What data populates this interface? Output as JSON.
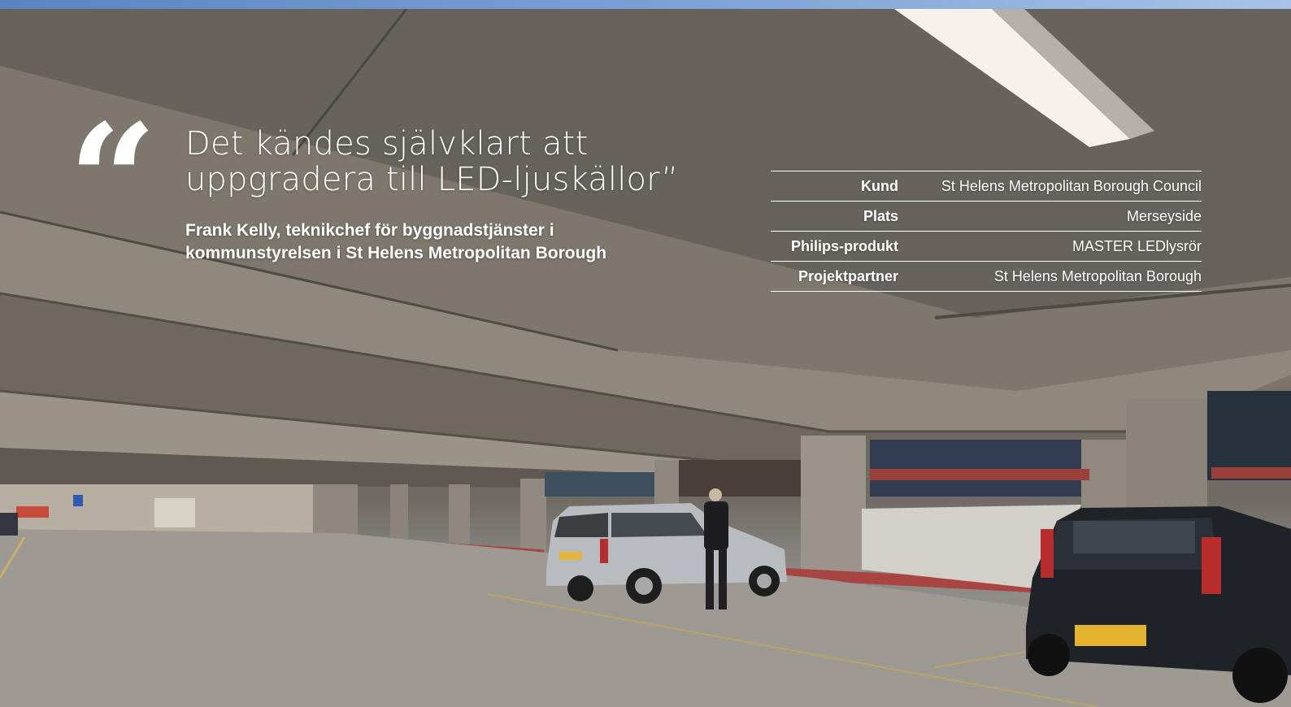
{
  "quote": {
    "mark": "“",
    "headline": "Det kändes självklart att uppgradera till LED-ljuskällor”",
    "attribution_line1": "Frank Kelly, teknikchef för byggnadstjänster i",
    "attribution_line2": "kommunstyrelsen i St Helens Metropolitan Borough"
  },
  "facts": [
    {
      "label": "Kund",
      "value": "St Helens Metropolitan Borough Council"
    },
    {
      "label": "Plats",
      "value": "Merseyside"
    },
    {
      "label": "Philips-produkt",
      "value": "MASTER LEDlysrör"
    },
    {
      "label": "Projektpartner",
      "value": "St Helens Metropolitan Borough"
    }
  ],
  "colors": {
    "top_bar": "#82a6d8",
    "text": "#ffffff"
  }
}
